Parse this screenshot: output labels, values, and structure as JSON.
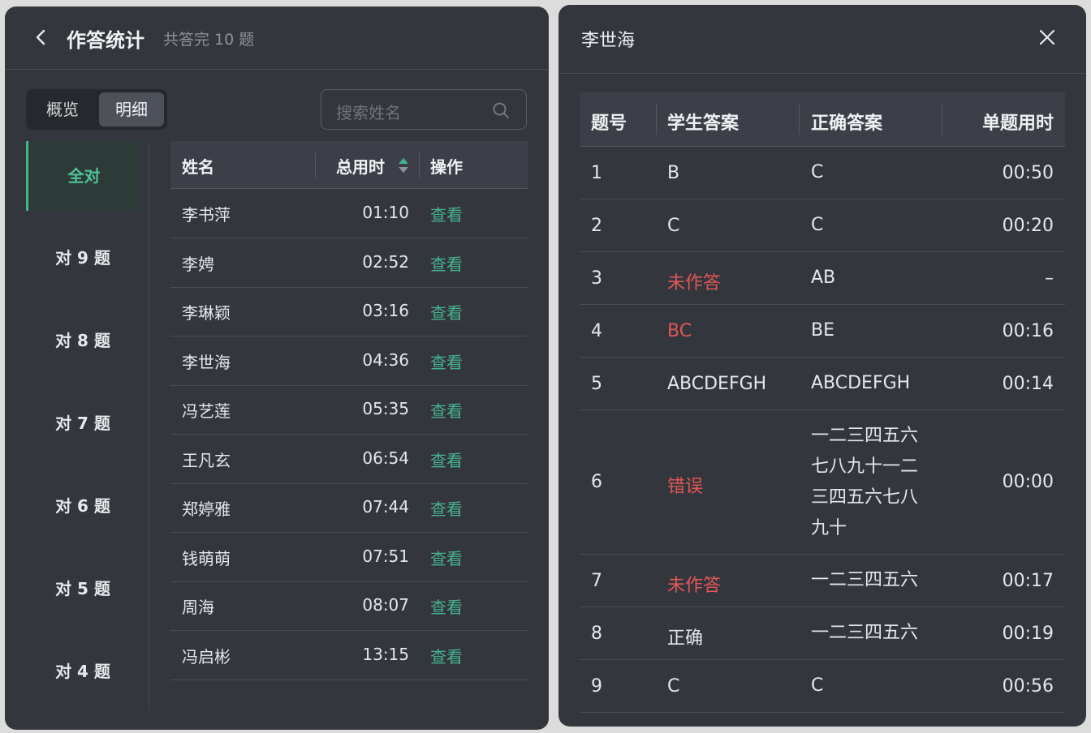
{
  "left_panel": {
    "title": "作答统计",
    "subtitle": "共答完 10 题",
    "tabs": [
      "概览",
      "明细"
    ],
    "search_placeholder": "搜索姓名",
    "categories": [
      "全对",
      "对 9 题",
      "对 8 题",
      "对 7 题",
      "对 6 题",
      "对 5 题",
      "对 4 题"
    ],
    "table": {
      "headers": {
        "name": "姓名",
        "time": "总用时",
        "action": "操作"
      },
      "rows": [
        {
          "name": "李书萍",
          "time": "01:10",
          "action": "查看"
        },
        {
          "name": "李娉",
          "time": "02:52",
          "action": "查看"
        },
        {
          "name": "李琳颖",
          "time": "03:16",
          "action": "查看"
        },
        {
          "name": "李世海",
          "time": "04:36",
          "action": "查看"
        },
        {
          "name": "冯艺莲",
          "time": "05:35",
          "action": "查看"
        },
        {
          "name": "王凡玄",
          "time": "06:54",
          "action": "查看"
        },
        {
          "name": "郑婷雅",
          "time": "07:44",
          "action": "查看"
        },
        {
          "name": "钱萌萌",
          "time": "07:51",
          "action": "查看"
        },
        {
          "name": "周海",
          "time": "08:07",
          "action": "查看"
        },
        {
          "name": "冯启彬",
          "time": "13:15",
          "action": "查看"
        }
      ]
    }
  },
  "right_panel": {
    "title": "李世海",
    "table": {
      "headers": {
        "no": "题号",
        "student": "学生答案",
        "correct": "正确答案",
        "time": "单题用时"
      },
      "rows": [
        {
          "no": "1",
          "student": "B",
          "correct": "C",
          "time": "00:50",
          "wrong": false
        },
        {
          "no": "2",
          "student": "C",
          "correct": "C",
          "time": "00:20",
          "wrong": false
        },
        {
          "no": "3",
          "student": "未作答",
          "correct": "AB",
          "time": "–",
          "wrong": true
        },
        {
          "no": "4",
          "student": "BC",
          "correct": "BE",
          "time": "00:16",
          "wrong": true
        },
        {
          "no": "5",
          "student": "ABCDEFGH",
          "correct": "ABCDEFGH",
          "time": "00:14",
          "wrong": false
        },
        {
          "no": "6",
          "student": "错误",
          "correct": "一二三四五六\n七八九十一二\n三四五六七八\n九十",
          "time": "00:00",
          "wrong": true
        },
        {
          "no": "7",
          "student": "未作答",
          "correct": "一二三四五六",
          "time": "00:17",
          "wrong": true
        },
        {
          "no": "8",
          "student": "正确",
          "correct": "一二三四五六",
          "time": "00:19",
          "wrong": false
        },
        {
          "no": "9",
          "student": "C",
          "correct": "C",
          "time": "00:56",
          "wrong": false
        }
      ]
    }
  },
  "colors": {
    "accent": "#46b38f",
    "error": "#e05757",
    "panel_bg": "#33363d"
  },
  "icons": [
    "back-icon",
    "search-icon",
    "sort-icon",
    "close-icon"
  ]
}
